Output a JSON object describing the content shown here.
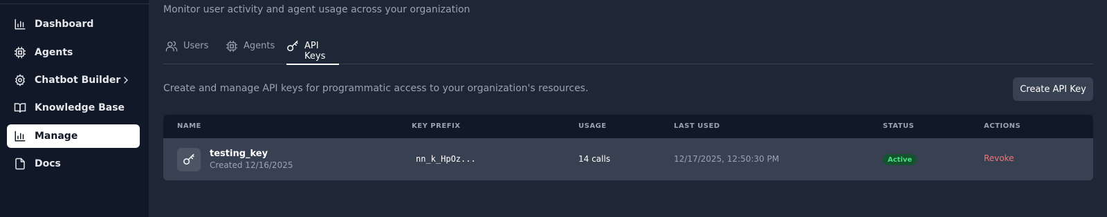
{
  "sidebar": {
    "items": [
      {
        "label": "Dashboard",
        "icon": "bar-chart-icon"
      },
      {
        "label": "Agents",
        "icon": "cpu-icon"
      },
      {
        "label": "Chatbot Builder",
        "icon": "gear-icon"
      },
      {
        "label": "Knowledge Base",
        "icon": "book-icon"
      },
      {
        "label": "Manage",
        "icon": "bar-chart-icon",
        "active": true
      },
      {
        "label": "Docs",
        "icon": "file-icon"
      }
    ]
  },
  "header": {
    "subtitle": "Monitor user activity and agent usage across your organization"
  },
  "tabs": [
    {
      "label": "Users",
      "icon": "users-icon"
    },
    {
      "label": "Agents",
      "icon": "cpu-icon"
    },
    {
      "label": "API Keys",
      "icon": "key-icon",
      "active": true
    }
  ],
  "api_keys": {
    "description": "Create and manage API keys for programmatic access to your organization's resources.",
    "create_label": "Create API Key",
    "columns": [
      "NAME",
      "KEY PREFIX",
      "USAGE",
      "LAST USED",
      "STATUS",
      "ACTIONS"
    ],
    "rows": [
      {
        "name": "testing_key",
        "created": "Created 12/16/2025",
        "prefix": "nn_k_HpOz...",
        "usage": "14 calls",
        "last_used": "12/17/2025, 12:50:30 PM",
        "status": "Active",
        "action": "Revoke"
      }
    ]
  },
  "colors": {
    "sidebar_bg": "#111827",
    "main_bg": "#1e2736",
    "active_badge": "#4ade80",
    "revoke": "#f87171"
  }
}
